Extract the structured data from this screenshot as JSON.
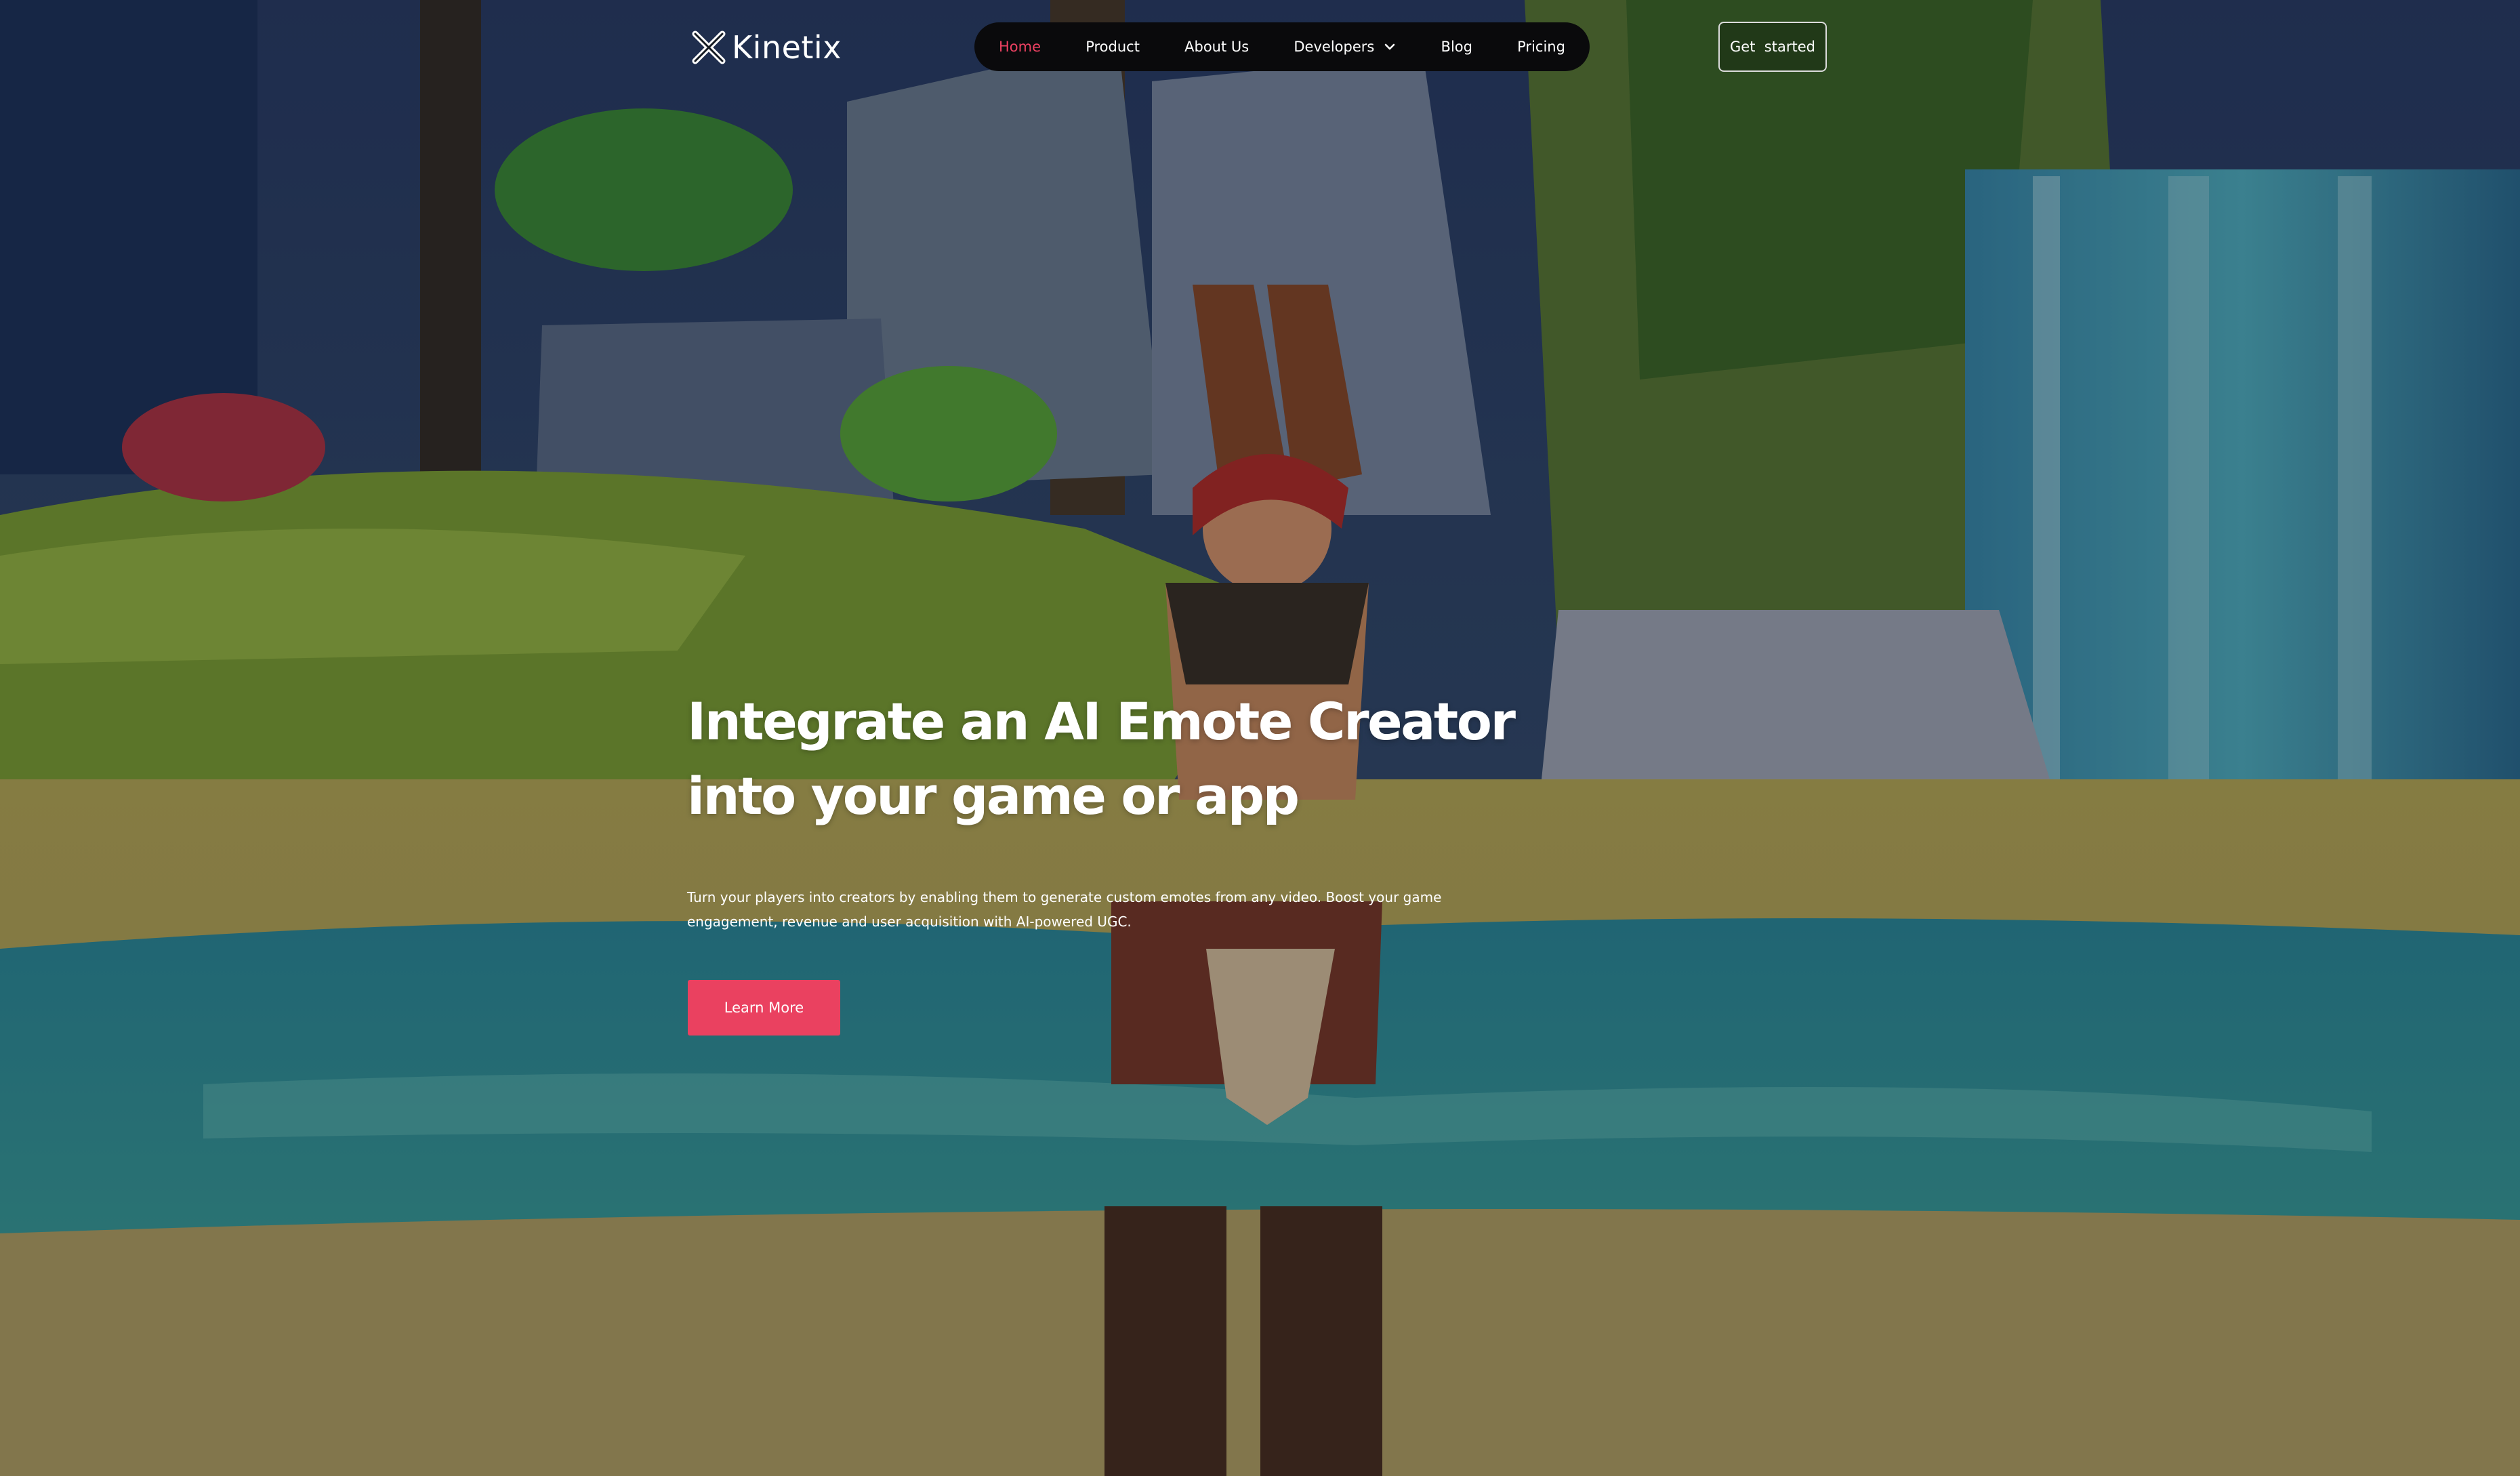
{
  "brand": {
    "name": "Kinetix",
    "logo_icon": "kinetix-x-icon"
  },
  "nav": {
    "items": [
      {
        "label": "Home",
        "active": true
      },
      {
        "label": "Product"
      },
      {
        "label": "About Us"
      },
      {
        "label": "Developers",
        "has_dropdown": true,
        "icon": "chevron-down-icon"
      },
      {
        "label": "Blog"
      },
      {
        "label": "Pricing"
      }
    ]
  },
  "header": {
    "cta_label": "Get  started"
  },
  "hero": {
    "headline_line1": "Integrate an AI Emote Creator",
    "headline_line2": "into your game or app",
    "subtext": "Turn your players into creators by enabling them to generate custom emotes from any video. Boost your game engagement, revenue and user acquisition with AI-powered UGC.",
    "cta_label": "Learn More"
  },
  "colors": {
    "accent": "#ea4160",
    "nav_bg": "#0a0a0c",
    "active_nav": "#ee4162"
  }
}
